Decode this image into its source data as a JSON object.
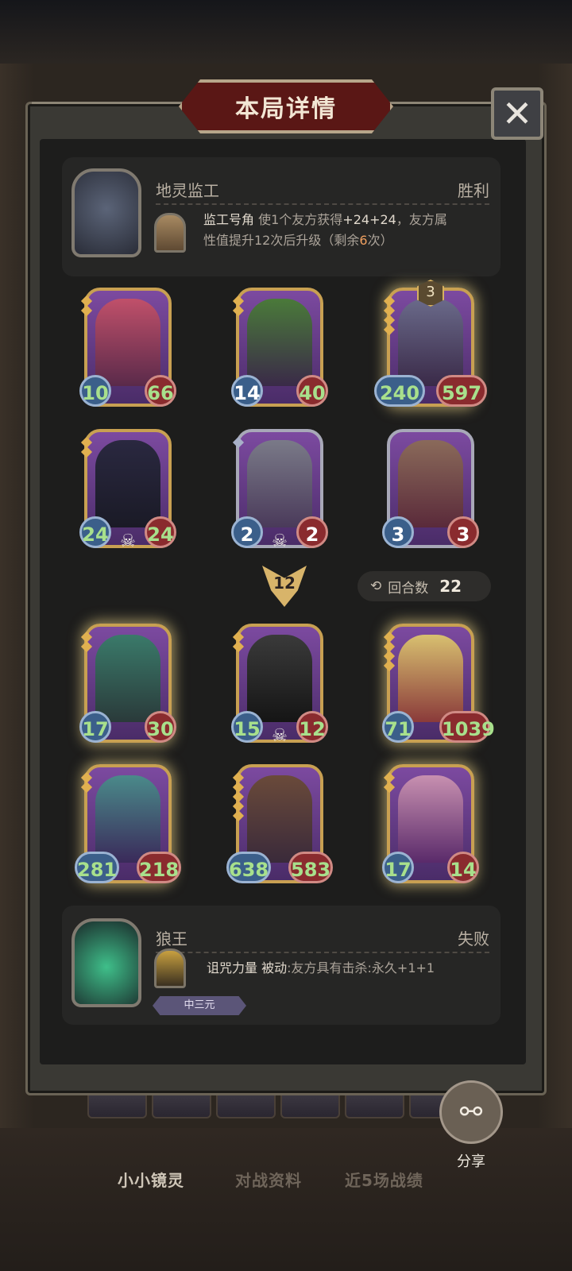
{
  "title": "本局详情",
  "close_icon": "✕",
  "player": {
    "name": "地灵监工",
    "result": "胜利",
    "skill_name": "监工号角",
    "skill_desc_1": "使1个友方获得",
    "skill_bonus": "+24+24",
    "skill_desc_2": "，友方属",
    "skill_line2_a": "性值提升12次后升级（剩余",
    "skill_remaining": "6",
    "skill_line2_b": "次）"
  },
  "player_cards": [
    {
      "attack": "10",
      "health": "66"
    },
    {
      "attack": "14",
      "health": "40"
    },
    {
      "attack": "240",
      "health": "597",
      "level": "3"
    },
    {
      "attack": "24",
      "health": "24"
    },
    {
      "attack": "2",
      "health": "2"
    },
    {
      "attack": "3",
      "health": "3"
    }
  ],
  "damage": "12",
  "rounds_label": "回合数",
  "rounds_value": "22",
  "opponent_cards": [
    {
      "attack": "17",
      "health": "30"
    },
    {
      "attack": "15",
      "health": "12"
    },
    {
      "attack": "71",
      "health": "1039"
    },
    {
      "attack": "281",
      "health": "218"
    },
    {
      "attack": "638",
      "health": "583"
    },
    {
      "attack": "17",
      "health": "14"
    }
  ],
  "opponent": {
    "name": "狼王",
    "result": "失败",
    "skill_name": "诅咒力量",
    "skill_type": "被动",
    "skill_desc": ":友方具有击杀:永久+1+1",
    "tag": "中三元"
  },
  "share_label": "分享",
  "bottom_tabs": [
    "小小镜灵",
    "对战资料",
    "近5场战绩"
  ],
  "icons": {
    "close": "close-icon",
    "share": "share-icon",
    "rounds": "refresh-icon",
    "skull": "skull-icon"
  }
}
